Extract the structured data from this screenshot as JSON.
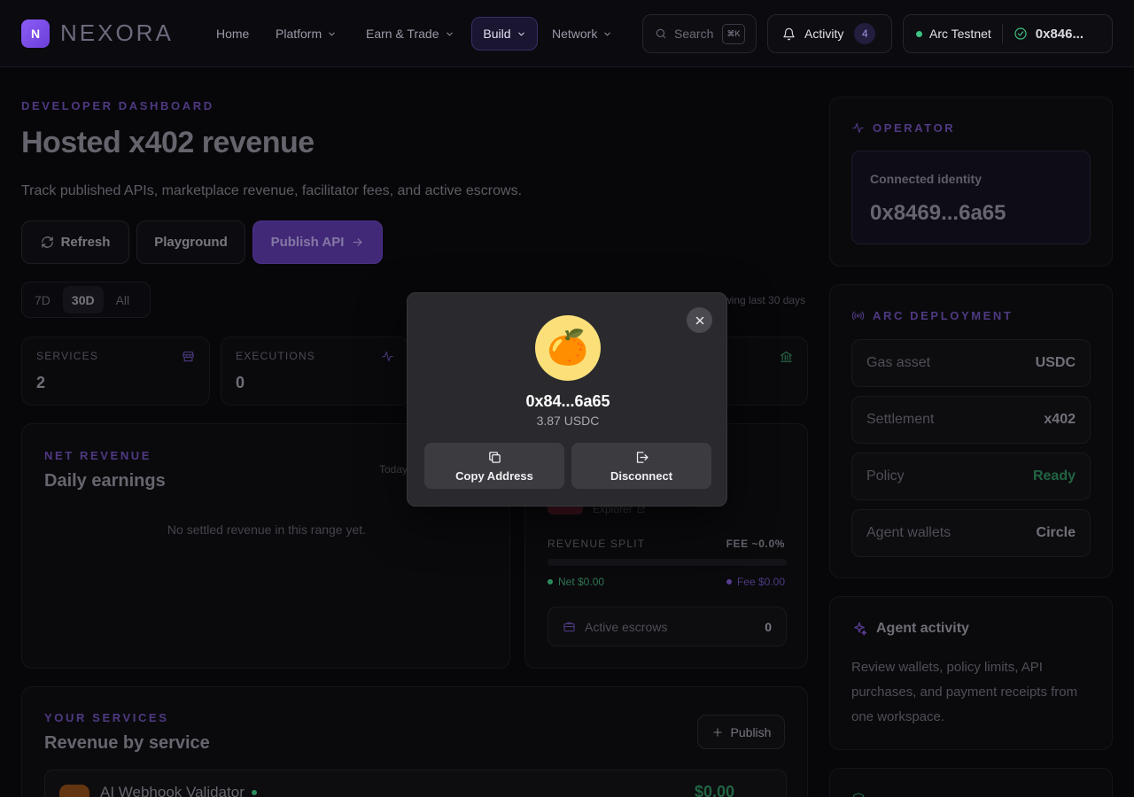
{
  "nav": {
    "logo_initial": "N",
    "logo_text": "NEXORA",
    "links": [
      {
        "label": "Home"
      },
      {
        "label": "Platform"
      },
      {
        "label": "Earn & Trade"
      },
      {
        "label": "Build"
      },
      {
        "label": "Network"
      }
    ],
    "search_placeholder": "Search",
    "search_shortcut": "⌘K",
    "activity_label": "Activity",
    "activity_count": "4",
    "network_name": "Arc Testnet",
    "wallet_short": "0x846..."
  },
  "header": {
    "eyebrow": "DEVELOPER DASHBOARD",
    "title": "Hosted x402 revenue",
    "subtitle": "Track published APIs, marketplace revenue, facilitator fees, and active escrows.",
    "refresh": "Refresh",
    "playground": "Playground",
    "publish_api": "Publish API"
  },
  "range": {
    "options": [
      "7D",
      "30D",
      "All"
    ],
    "selected": "30D",
    "note": "wing last 30 days"
  },
  "stats": [
    {
      "label": "SERVICES",
      "value": "2"
    },
    {
      "label": "EXECUTIONS",
      "value": "0"
    }
  ],
  "net_revenue": {
    "eyebrow": "NET REVENUE",
    "title": "Daily earnings",
    "range_label": "Today",
    "empty": "No settled revenue in this range yet."
  },
  "split": {
    "explorer": "Explorer",
    "label": "REVENUE SPLIT",
    "fee_label": "FEE ~0.0%",
    "net": "Net $0.00",
    "fee": "Fee $0.00",
    "escrows_label": "Active escrows",
    "escrows_value": "0"
  },
  "services": {
    "eyebrow": "YOUR SERVICES",
    "title": "Revenue by service",
    "publish": "Publish",
    "first_name": "AI Webhook Validator",
    "first_amount": "$0.00"
  },
  "operator": {
    "eyebrow": "OPERATOR",
    "identity_label": "Connected identity",
    "identity_value": "0x8469...6a65"
  },
  "deployment": {
    "eyebrow": "ARC DEPLOYMENT",
    "rows": [
      {
        "key": "Gas asset",
        "value": "USDC"
      },
      {
        "key": "Settlement",
        "value": "x402"
      },
      {
        "key": "Policy",
        "value": "Ready"
      },
      {
        "key": "Agent wallets",
        "value": "Circle"
      }
    ]
  },
  "agent": {
    "title": "Agent activity",
    "desc": "Review wallets, policy limits, API purchases, and payment receipts from one workspace."
  },
  "modal": {
    "avatar_emoji": "🍊",
    "address": "0x84...6a65",
    "balance": "3.87 USDC",
    "copy": "Copy Address",
    "disconnect": "Disconnect"
  },
  "colors": {
    "accent": "#7a54c9",
    "success": "#3fc381",
    "background": "#0a090d",
    "modal": "#2a2a2e"
  }
}
